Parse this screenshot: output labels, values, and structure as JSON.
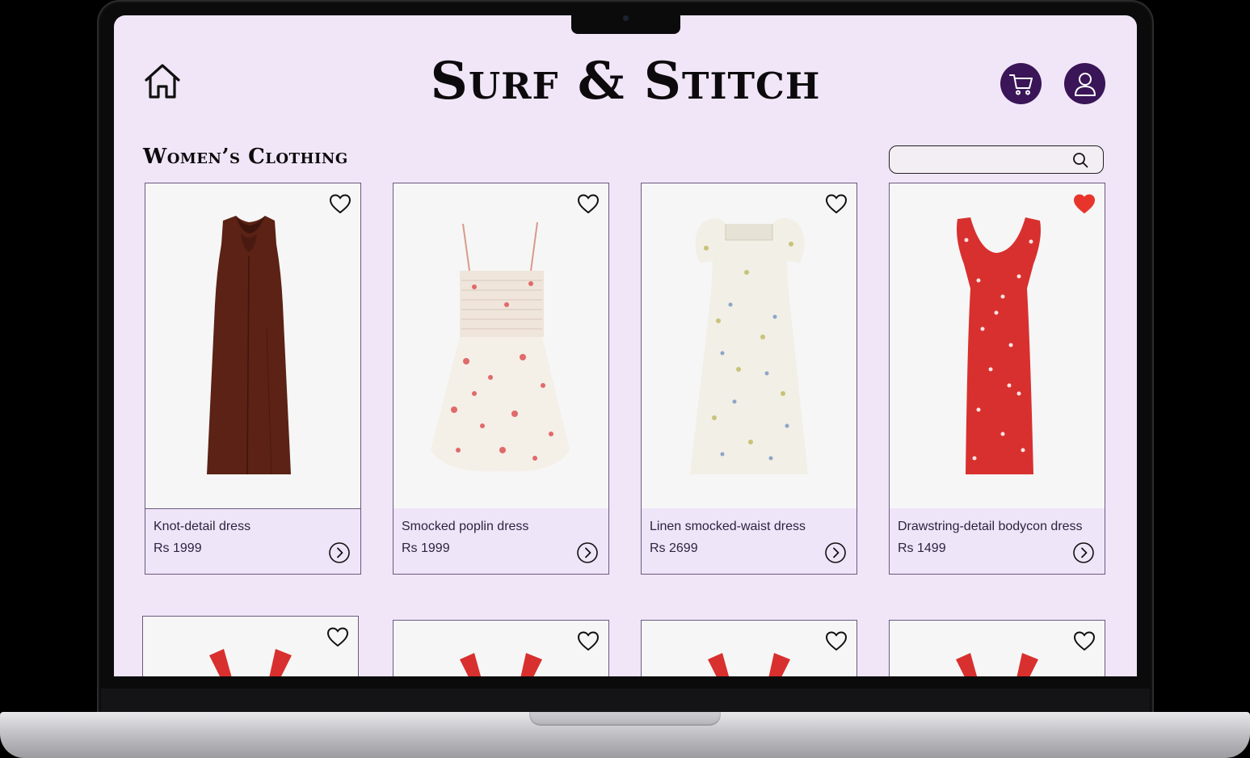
{
  "header": {
    "brand": "Surf & Stitch",
    "home_icon": "home-icon",
    "cart_icon": "cart-icon",
    "account_icon": "user-icon",
    "accent_color": "#3a1558"
  },
  "section": {
    "title": "Women’s Clothing",
    "search_placeholder": "",
    "search_icon": "search-icon"
  },
  "products": [
    {
      "name": "Knot-detail dress",
      "price": "Rs 1999",
      "favorited": false
    },
    {
      "name": "Smocked poplin dress",
      "price": "Rs 1999",
      "favorited": false
    },
    {
      "name": "Linen smocked-waist dress",
      "price": "Rs 2699",
      "favorited": false
    },
    {
      "name": "Drawstring-detail bodycon dress",
      "price": "Rs 1499",
      "favorited": true
    }
  ],
  "colors": {
    "background": "#f0e6f7",
    "favorite_active": "#e8352c"
  }
}
